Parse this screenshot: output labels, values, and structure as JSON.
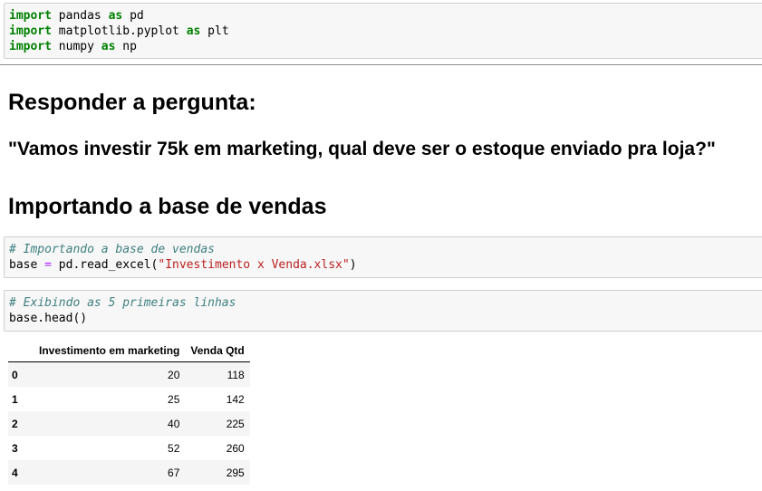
{
  "cells": {
    "imports": [
      {
        "kw": "import",
        "mod": " pandas ",
        "as": "as",
        "alias": " pd"
      },
      {
        "kw": "import",
        "mod": " matplotlib.pyplot ",
        "as": "as",
        "alias": " plt"
      },
      {
        "kw": "import",
        "mod": " numpy ",
        "as": "as",
        "alias": " np"
      }
    ],
    "read_excel": {
      "comment": "# Importando a base de vendas",
      "lhs": "base ",
      "eq": "=",
      "call": " pd.read_excel(",
      "str": "\"Investimento x Venda.xlsx\"",
      "close": ")"
    },
    "head": {
      "comment": "# Exibindo as 5 primeiras linhas",
      "code": "base.head()"
    }
  },
  "headings": {
    "responder": "Responder a pergunta:",
    "question": "\"Vamos investir 75k em marketing, qual deve ser o estoque enviado pra loja?\"",
    "importando": "Importando a base de vendas"
  },
  "dataframe": {
    "columns": [
      "Investimento em marketing",
      "Venda Qtd"
    ],
    "rows": [
      {
        "index": "0",
        "invest": "20",
        "venda": "118"
      },
      {
        "index": "1",
        "invest": "25",
        "venda": "142"
      },
      {
        "index": "2",
        "invest": "40",
        "venda": "225"
      },
      {
        "index": "3",
        "invest": "52",
        "venda": "260"
      },
      {
        "index": "4",
        "invest": "67",
        "venda": "295"
      }
    ]
  }
}
